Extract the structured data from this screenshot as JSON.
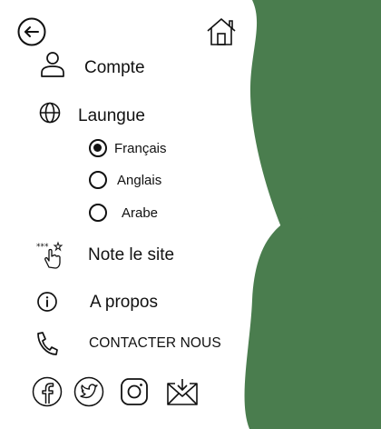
{
  "theme": {
    "accent": "#4a7d4e",
    "text": "#111111",
    "background": "#ffffff"
  },
  "header": {
    "back_icon": "arrow-left-circle-icon",
    "home_icon": "home-icon"
  },
  "menu": {
    "account": {
      "label": "Compte",
      "icon": "user-icon"
    },
    "language": {
      "label": "Laungue",
      "icon": "globe-icon",
      "selected": "Français",
      "options": [
        {
          "label": "Français",
          "selected": true
        },
        {
          "label": "Anglais",
          "selected": false
        },
        {
          "label": "Arabe",
          "selected": false
        }
      ]
    },
    "rate": {
      "label": "Note le site",
      "icon": "rating-hand-icon"
    },
    "about": {
      "label": "A propos",
      "icon": "info-icon"
    },
    "contact": {
      "label": "CONTACTER NOUS",
      "icon": "phone-icon"
    }
  },
  "social": {
    "icons": [
      "facebook-icon",
      "twitter-icon",
      "instagram-icon",
      "mail-icon"
    ]
  }
}
